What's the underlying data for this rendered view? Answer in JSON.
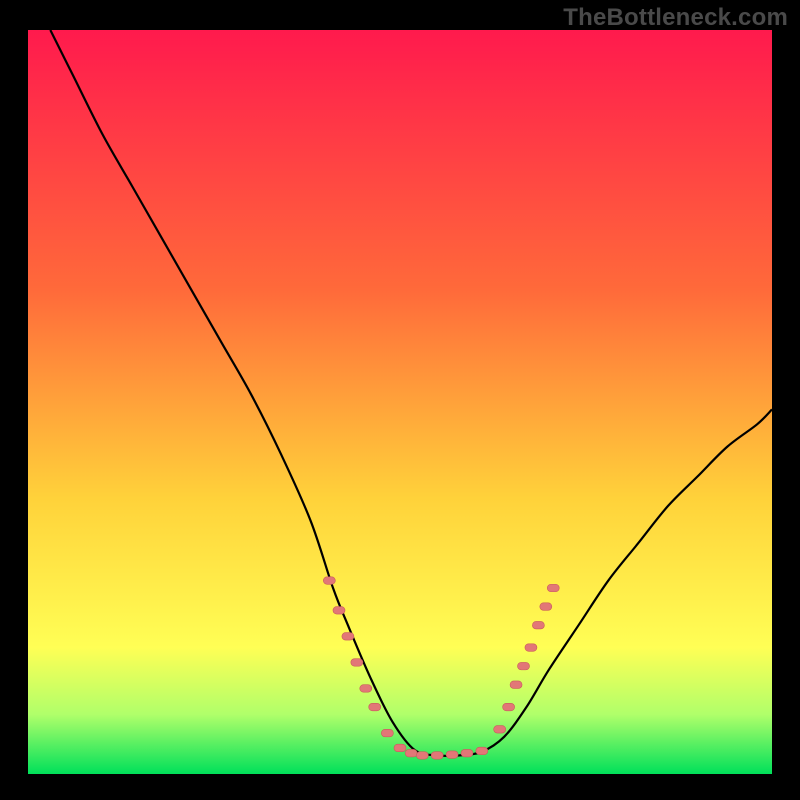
{
  "watermark": "TheBottleneck.com",
  "colors": {
    "bg": "#000000",
    "grad_top": "#ff1a4d",
    "grad_mid1": "#ff6a3a",
    "grad_mid2": "#ffd23a",
    "grad_low": "#ffff55",
    "grad_green_light": "#b0ff6a",
    "grad_green": "#00e05a",
    "curve": "#000000",
    "marker_fill": "#e27777",
    "marker_stroke": "#c95c5c"
  },
  "chart_data": {
    "type": "line",
    "title": "",
    "xlabel": "",
    "ylabel": "",
    "xlim": [
      0,
      100
    ],
    "ylim": [
      0,
      100
    ],
    "curve": {
      "x": [
        3,
        6,
        10,
        14,
        18,
        22,
        26,
        30,
        34,
        38,
        41,
        43,
        46,
        49,
        52,
        55,
        58,
        61,
        64,
        67,
        70,
        74,
        78,
        82,
        86,
        90,
        94,
        98,
        100
      ],
      "y": [
        100,
        94,
        86,
        79,
        72,
        65,
        58,
        51,
        43,
        34,
        25,
        20,
        13,
        7,
        3.2,
        2.5,
        2.5,
        3,
        5,
        9,
        14,
        20,
        26,
        31,
        36,
        40,
        44,
        47,
        49
      ]
    },
    "markers": [
      {
        "x": 40.5,
        "y": 26
      },
      {
        "x": 41.8,
        "y": 22
      },
      {
        "x": 43.0,
        "y": 18.5
      },
      {
        "x": 44.2,
        "y": 15
      },
      {
        "x": 45.4,
        "y": 11.5
      },
      {
        "x": 46.6,
        "y": 9
      },
      {
        "x": 48.3,
        "y": 5.5
      },
      {
        "x": 50.0,
        "y": 3.5
      },
      {
        "x": 51.5,
        "y": 2.8
      },
      {
        "x": 53.0,
        "y": 2.5
      },
      {
        "x": 55.0,
        "y": 2.5
      },
      {
        "x": 57.0,
        "y": 2.6
      },
      {
        "x": 59.0,
        "y": 2.8
      },
      {
        "x": 61.0,
        "y": 3.1
      },
      {
        "x": 63.4,
        "y": 6
      },
      {
        "x": 64.6,
        "y": 9
      },
      {
        "x": 65.6,
        "y": 12
      },
      {
        "x": 66.6,
        "y": 14.5
      },
      {
        "x": 67.6,
        "y": 17
      },
      {
        "x": 68.6,
        "y": 20
      },
      {
        "x": 69.6,
        "y": 22.5
      },
      {
        "x": 70.6,
        "y": 25
      }
    ],
    "gradient_stops": [
      {
        "offset": 0.0,
        "key": "grad_top"
      },
      {
        "offset": 0.35,
        "key": "grad_mid1"
      },
      {
        "offset": 0.63,
        "key": "grad_mid2"
      },
      {
        "offset": 0.83,
        "key": "grad_low"
      },
      {
        "offset": 0.92,
        "key": "grad_green_light"
      },
      {
        "offset": 1.0,
        "key": "grad_green"
      }
    ]
  }
}
